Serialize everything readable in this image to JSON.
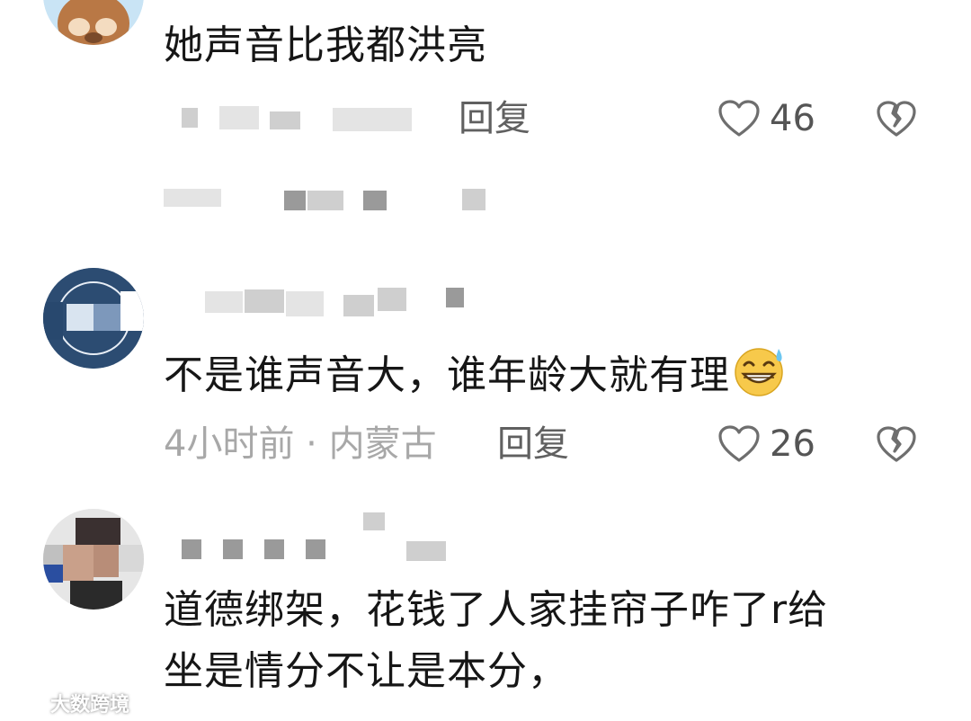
{
  "comments": [
    {
      "content": "她声音比我都洪亮",
      "reply_label": "回复",
      "like_count": "46"
    },
    {
      "content": "不是谁声音大，谁年龄大就有理",
      "meta": "4小时前 · 内蒙古",
      "reply_label": "回复",
      "like_count": "26"
    },
    {
      "content_line1": "道德绑架，花钱了人家挂帘子咋了r给",
      "content_line2": "坐是情分不让是本分，"
    }
  ],
  "watermark": {
    "text": "大数跨境"
  },
  "colors": {
    "text": "#161616",
    "meta": "#a8a8a8",
    "reply": "#606060",
    "icon": "#6e6e6e",
    "pixelation": "#cfcfcf"
  },
  "icons": [
    "heart-outline-icon",
    "broken-heart-icon",
    "sweat-smile-emoji"
  ]
}
